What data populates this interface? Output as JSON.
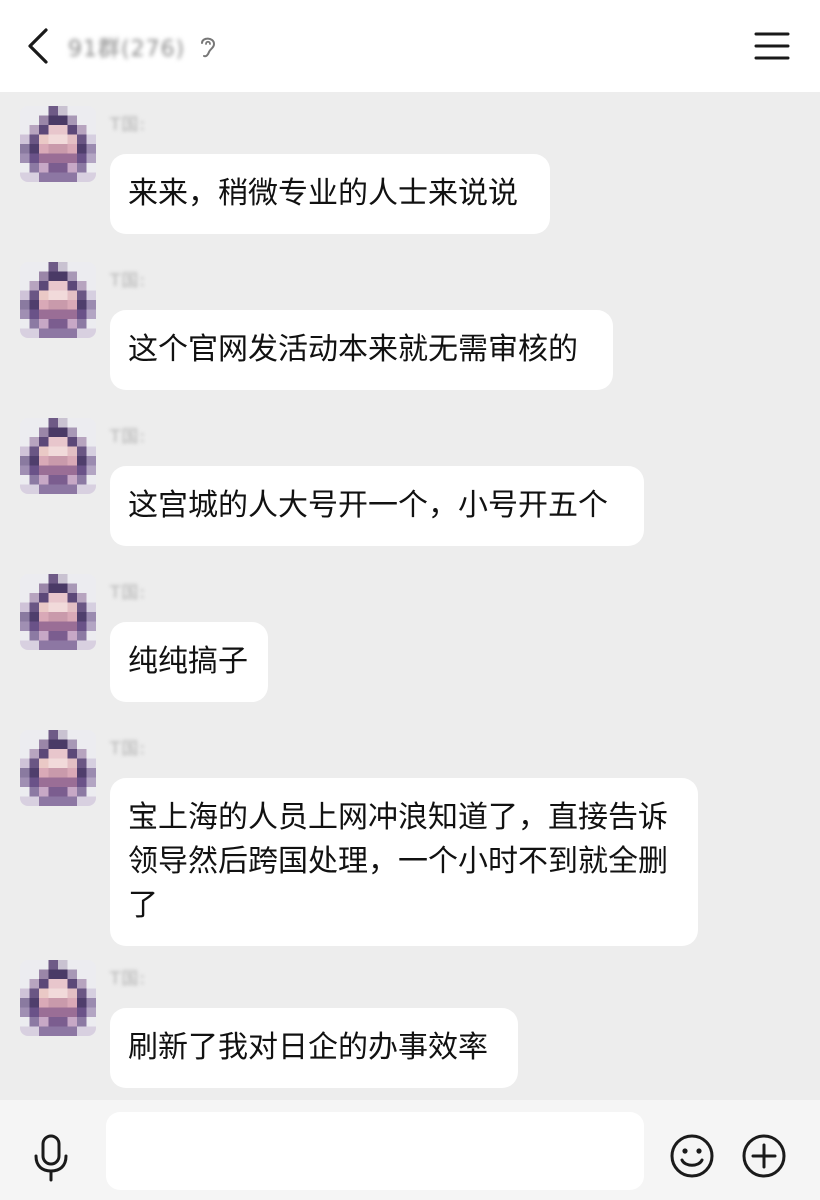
{
  "header": {
    "title": "91群(276)"
  },
  "input": {
    "placeholder": ""
  },
  "messages": [
    {
      "sender": "T国:",
      "text": "来来，稍微专业的人士来说说"
    },
    {
      "sender": "T国:",
      "text": "这个官网发活动本来就无需审核的"
    },
    {
      "sender": "T国:",
      "text": "这宫城的人大号开一个，小号开五个"
    },
    {
      "sender": "T国:",
      "text": "纯纯搞子"
    },
    {
      "sender": "T国:",
      "text": "宝上海的人员上网冲浪知道了，直接告诉领导然后跨国处理，一个小时不到就全删了"
    },
    {
      "sender": "T国:",
      "text": "刷新了我对日企的办事效率"
    }
  ],
  "icons": {
    "back": "back-chevron-icon",
    "ear": "ear-icon",
    "menu": "menu-icon",
    "mic": "microphone-icon",
    "emoji": "emoji-smile-icon",
    "plus": "plus-circle-icon"
  },
  "colors": {
    "background": "#ededed",
    "header": "#ffffff",
    "bubble": "#ffffff",
    "text": "#111111",
    "inputbar": "#f5f5f5"
  }
}
